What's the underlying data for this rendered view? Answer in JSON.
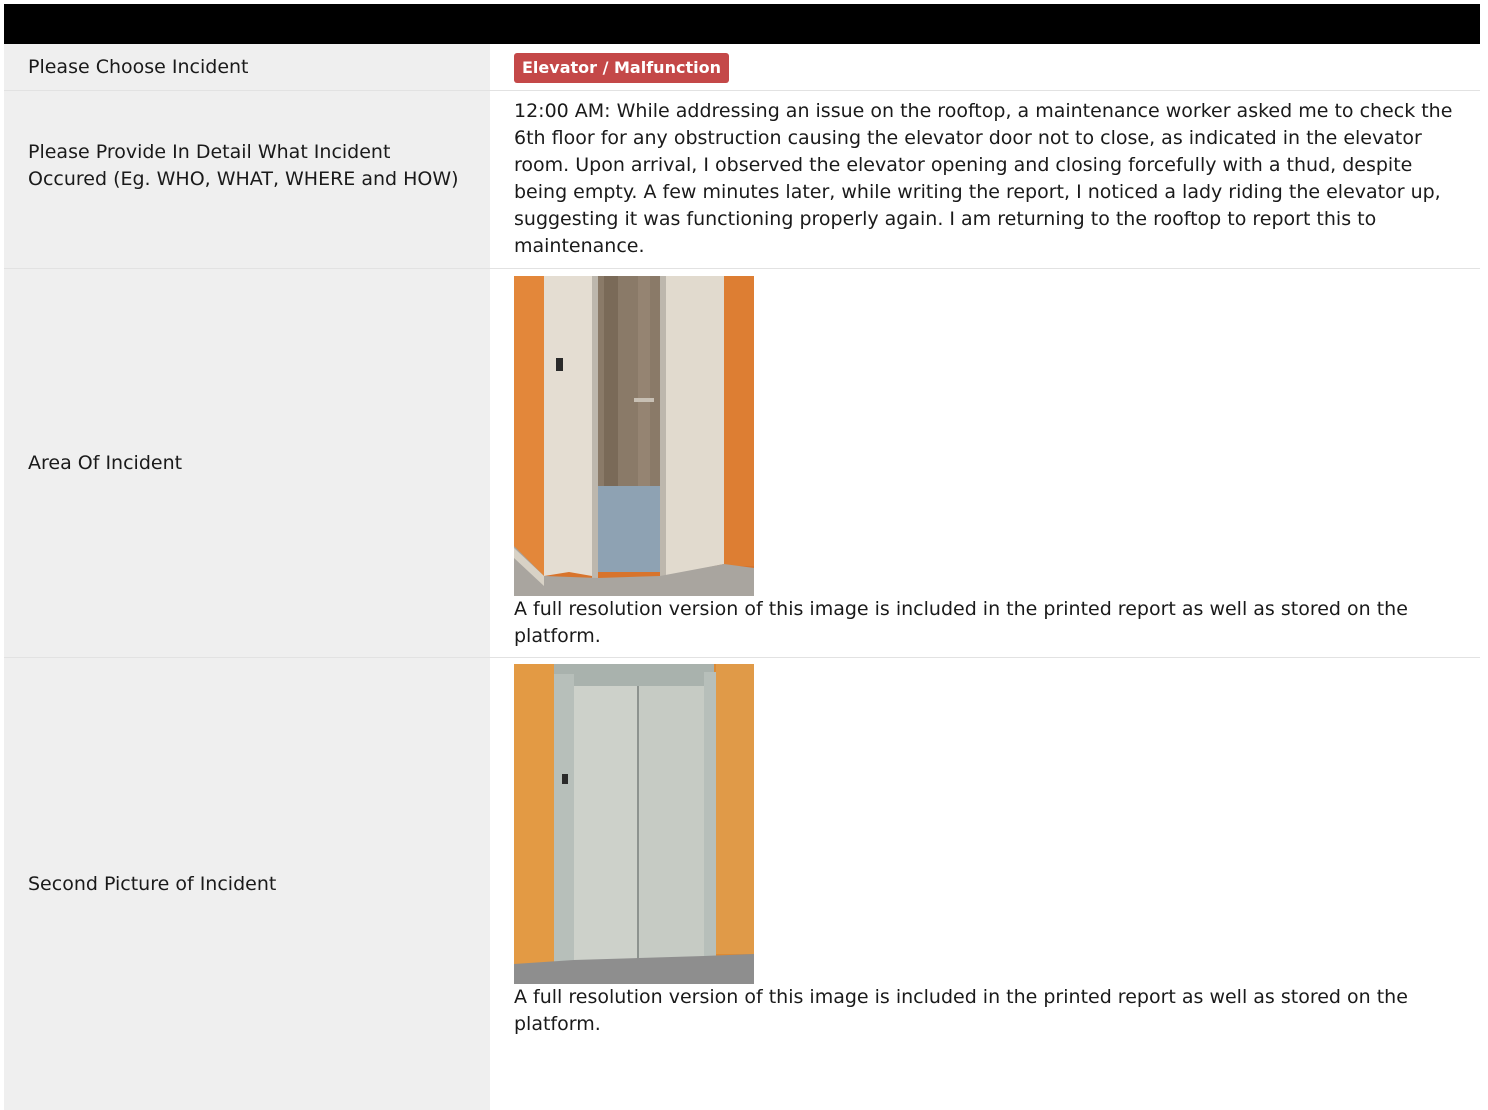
{
  "rows": [
    {
      "label": "Please Choose Incident",
      "badge": "Elevator / Malfunction",
      "badge_color": "#c44848"
    },
    {
      "label": "Please Provide In Detail What Incident Occured (Eg. WHO, WHAT, WHERE and HOW)",
      "text": "12:00 AM: While addressing an issue on the rooftop, a maintenance worker asked me to check the 6th floor for any obstruction causing the elevator door not to close, as indicated in the elevator room. Upon arrival, I observed the elevator opening and closing forcefully with a thud, despite being empty. A few minutes later, while writing the report, I noticed a lady riding the elevator up, suggesting it was functioning properly again. I am returning to the rooftop to report this to maintenance."
    },
    {
      "label": "Area Of Incident",
      "image": "elevator-door-open-photo",
      "caption": "A full resolution version of this image is included in the printed report as well as stored on the platform."
    },
    {
      "label": "Second Picture of Incident",
      "image": "elevator-door-closed-photo",
      "caption": "A full resolution version of this image is included in the printed report as well as stored on the platform."
    }
  ],
  "colors": {
    "header": "#000000",
    "label_background": "#efefef",
    "wall_orange": "#e0883e"
  }
}
